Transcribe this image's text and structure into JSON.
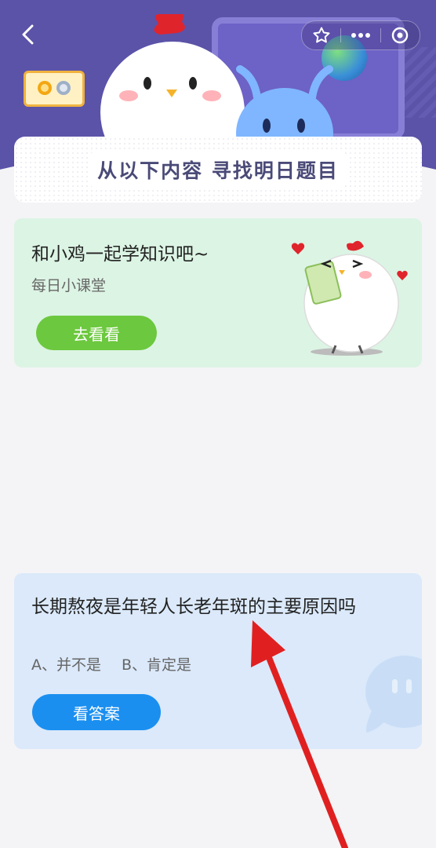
{
  "header": {
    "banner_title": "从以下内容  寻找明日题目"
  },
  "learn_card": {
    "title": "和小鸡一起学知识吧~",
    "subtitle": "每日小课堂",
    "button_label": "去看看"
  },
  "quiz_card": {
    "question": "长期熬夜是年轻人长老年斑的主要原因吗",
    "option_a": "A、并不是",
    "option_b": "B、肯定是",
    "button_label": "看答案"
  },
  "icons": {
    "back": "chevron-left-icon",
    "favorite": "star-icon",
    "more": "ellipsis-icon",
    "close": "target-icon"
  },
  "colors": {
    "header_bg": "#5b53a8",
    "green_card": "#dcf4e4",
    "green_button": "#6cc83e",
    "blue_card": "#dbe9fa",
    "blue_button": "#1a8ff0",
    "arrow": "#e02020"
  }
}
